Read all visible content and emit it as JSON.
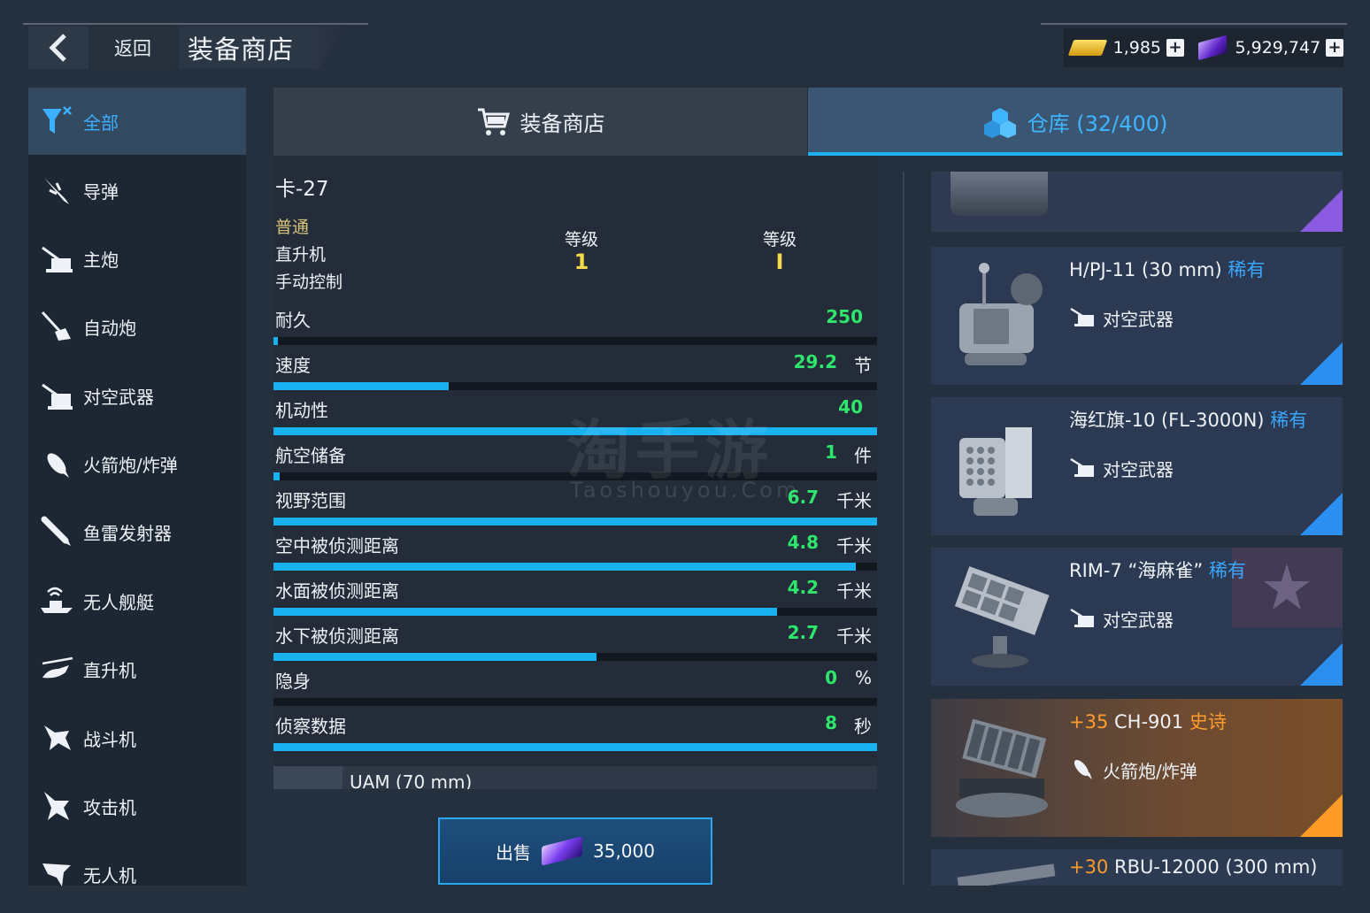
{
  "header": {
    "back_label": "返回",
    "title": "装备商店",
    "gold_amount": "1,985",
    "gem_amount": "5,929,747"
  },
  "sidebar": {
    "items": [
      {
        "label": "全部",
        "icon": "all-filter-icon",
        "active": true
      },
      {
        "label": "导弹",
        "icon": "missile-icon"
      },
      {
        "label": "主炮",
        "icon": "main-gun-icon"
      },
      {
        "label": "自动炮",
        "icon": "autocannon-icon"
      },
      {
        "label": "对空武器",
        "icon": "anti-air-icon"
      },
      {
        "label": "火箭炮/炸弹",
        "icon": "rocket-bomb-icon"
      },
      {
        "label": "鱼雷发射器",
        "icon": "torpedo-icon"
      },
      {
        "label": "无人舰艇",
        "icon": "drone-boat-icon"
      },
      {
        "label": "直升机",
        "icon": "helicopter-icon"
      },
      {
        "label": "战斗机",
        "icon": "fighter-icon"
      },
      {
        "label": "攻击机",
        "icon": "attack-plane-icon"
      },
      {
        "label": "无人机",
        "icon": "uav-icon"
      }
    ]
  },
  "tabs": {
    "store_label": "装备商店",
    "warehouse_label": "仓库 (32/400)"
  },
  "detail": {
    "name": "卡-27",
    "quality": "普通",
    "category": "直升机",
    "control": "手动控制",
    "level_label_1": "等级",
    "level_value_1": "1",
    "level_label_2": "等级",
    "level_value_2": "I",
    "stats": [
      {
        "label": "耐久",
        "value": "250",
        "unit": "",
        "fill": 0.003
      },
      {
        "label": "速度",
        "value": "29.2",
        "unit": "节",
        "fill": 0.29
      },
      {
        "label": "机动性",
        "value": "40",
        "unit": "",
        "fill": 1.0
      },
      {
        "label": "航空储备",
        "value": "1",
        "unit": "件",
        "fill": 0.01
      },
      {
        "label": "视野范围",
        "value": "6.7",
        "unit": "千米",
        "fill": 1.0
      },
      {
        "label": "空中被侦测距离",
        "value": "4.8",
        "unit": "千米",
        "fill": 0.965
      },
      {
        "label": "水面被侦测距离",
        "value": "4.2",
        "unit": "千米",
        "fill": 0.835
      },
      {
        "label": "水下被侦测距离",
        "value": "2.7",
        "unit": "千米",
        "fill": 0.535
      },
      {
        "label": "隐身",
        "value": "0",
        "unit": "%",
        "fill": 0
      },
      {
        "label": "侦察数据",
        "value": "8",
        "unit": "秒",
        "fill": 1.0
      }
    ],
    "sub_weapon": "UAM (70 mm)"
  },
  "sell": {
    "label": "出售",
    "price": "35,000"
  },
  "watermark": {
    "text": "淘手游",
    "sub": "Taoshouyou.Com"
  },
  "warehouse_items": [
    {
      "prefix": "",
      "name": "H/PJ-11 (30 mm)",
      "rarity": "稀有",
      "type": "对空武器",
      "rarity_class": "rare"
    },
    {
      "prefix": "",
      "name": "海红旗-10 (FL-3000N)",
      "rarity": "稀有",
      "type": "对空武器",
      "rarity_class": "rare"
    },
    {
      "prefix": "",
      "name": "RIM-7 “海麻雀”",
      "rarity": "稀有",
      "type": "对空武器",
      "rarity_class": "rare"
    },
    {
      "prefix": "+35",
      "name": "CH-901",
      "rarity": "史诗",
      "type": "火箭炮/炸弹",
      "rarity_class": "epic"
    },
    {
      "prefix": "+30",
      "name": "RBU-12000 (300 mm)",
      "rarity": "",
      "type": "",
      "rarity_class": "epic"
    }
  ],
  "colors": {
    "accent": "#1fb0f0",
    "stat_value": "#2ee66c",
    "rare": "#3aa7ff",
    "epic": "#ff9c2b",
    "quality_common": "#d9c37a"
  }
}
